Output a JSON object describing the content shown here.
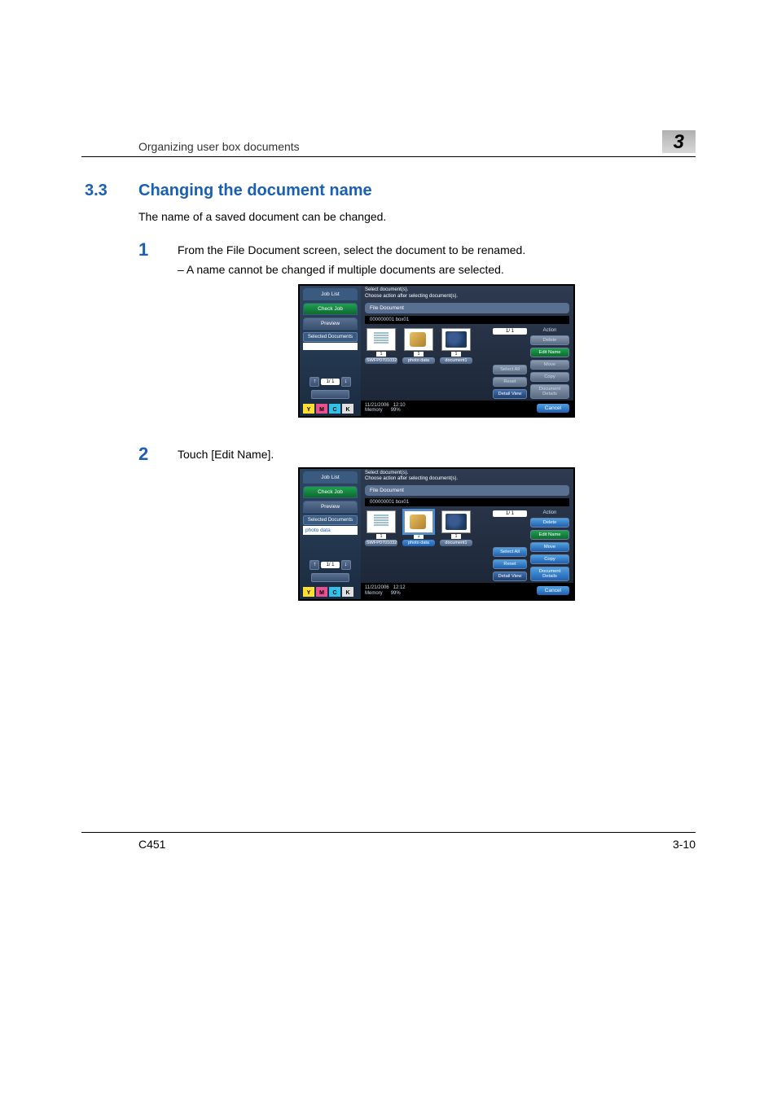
{
  "page": {
    "header_title": "Organizing user box documents",
    "chapter": "3",
    "footer_model": "C451",
    "footer_page": "3-10"
  },
  "section": {
    "number": "3.3",
    "title": "Changing the document name",
    "intro": "The name of a saved document can be changed."
  },
  "step1": {
    "num": "1",
    "text": "From the File Document screen, select the document to be renamed.",
    "bullet": "– A name cannot be changed if multiple documents are selected."
  },
  "step2": {
    "num": "2",
    "text": "Touch [Edit Name]."
  },
  "screen1": {
    "job_list": "Job List",
    "check_job": "Check Job",
    "preview": "Preview",
    "selected_documents": "Selected Documents",
    "selected_value": "",
    "pager": "1/ 1",
    "supplies": {
      "y": "Y",
      "m": "M",
      "c": "C",
      "k": "K"
    },
    "instruction_l1": "Select document(s).",
    "instruction_l2": "Choose action after selecting document(s).",
    "file_document": "File Document",
    "box_name": "000000001  box01",
    "small_page": "1/ 1",
    "thumbs": [
      {
        "count": "1",
        "label": "SWFP0701032"
      },
      {
        "count": "1",
        "label": "photo data"
      },
      {
        "count": "1",
        "label": "document1"
      }
    ],
    "mid": {
      "select_all": "Select\nAll",
      "reset": "Reset",
      "detail_view": "Detail\nView"
    },
    "actions": {
      "header": "Action",
      "delete": "Delete",
      "edit_name": "Edit Name",
      "move": "Move",
      "copy": "Copy",
      "doc_details": "Document\nDetails"
    },
    "date": "11/21/2006",
    "time": "12:10",
    "memory": "Memory",
    "memory_pct": "99%",
    "cancel": "Cancel"
  },
  "screen2": {
    "job_list": "Job List",
    "check_job": "Check Job",
    "preview": "Preview",
    "selected_documents": "Selected Documents",
    "selected_value": "photo data",
    "pager": "1/ 1",
    "supplies": {
      "y": "Y",
      "m": "M",
      "c": "C",
      "k": "K"
    },
    "instruction_l1": "Select document(s).",
    "instruction_l2": "Choose action after selecting document(s).",
    "file_document": "File Document",
    "box_name": "000000001  box01",
    "small_page": "1/ 1",
    "thumbs": [
      {
        "count": "1",
        "label": "SWFP0701032"
      },
      {
        "count": "1",
        "label": "photo data"
      },
      {
        "count": "1",
        "label": "document1"
      }
    ],
    "mid": {
      "select_all": "Select\nAll",
      "reset": "Reset",
      "detail_view": "Detail\nView"
    },
    "actions": {
      "header": "Action",
      "delete": "Delete",
      "edit_name": "Edit Name",
      "move": "Move",
      "copy": "Copy",
      "doc_details": "Document\nDetails"
    },
    "date": "11/21/2006",
    "time": "12:12",
    "memory": "Memory",
    "memory_pct": "99%",
    "cancel": "Cancel"
  }
}
